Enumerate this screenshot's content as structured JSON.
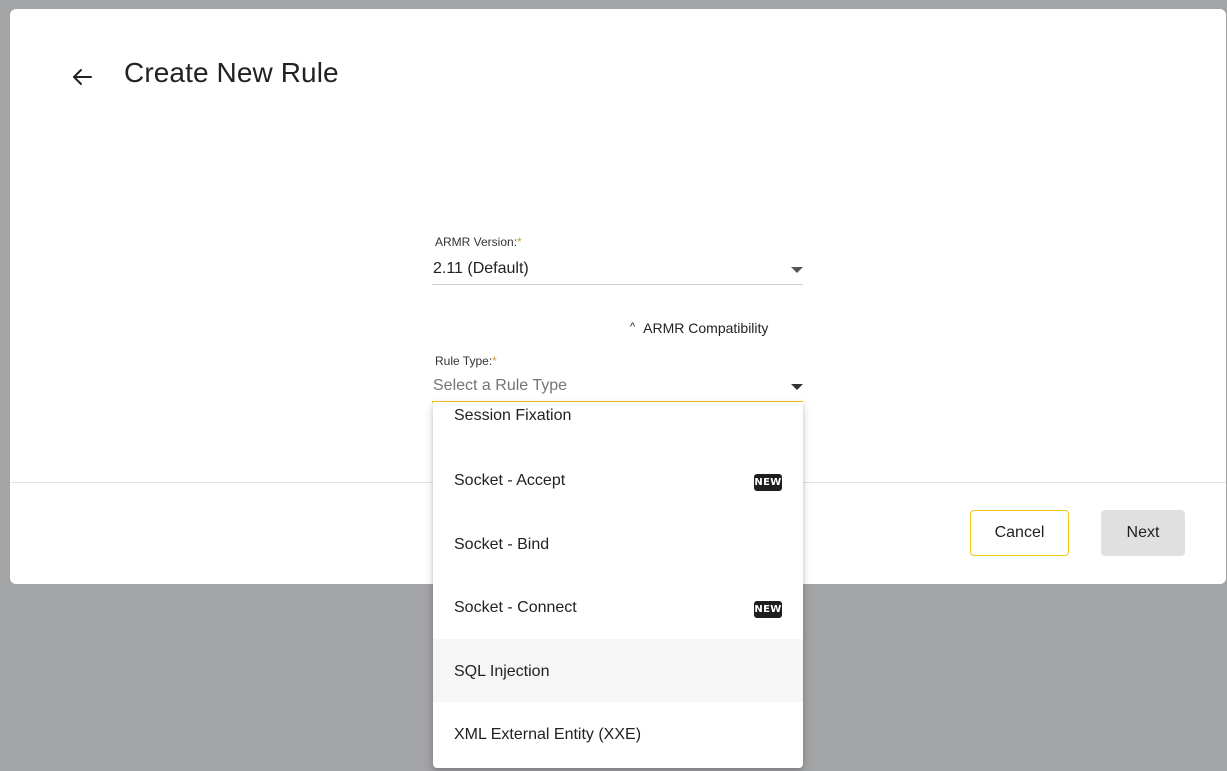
{
  "header": {
    "title": "Create New Rule",
    "back_icon": "arrow-left-icon"
  },
  "form": {
    "armr_version": {
      "label": "ARMR Version:",
      "required_mark": "*",
      "value": "2.11 (Default)"
    },
    "compatibility_toggle": {
      "label": "ARMR Compatibility",
      "icon": "chevron-up-icon",
      "glyph": "^"
    },
    "rule_type": {
      "label": "Rule Type:",
      "required_mark": "*",
      "placeholder": "Select a Rule Type"
    }
  },
  "dropdown": {
    "options": [
      {
        "label": "Session Fixation",
        "badge": ""
      },
      {
        "label": "Socket - Accept",
        "badge": "NEW"
      },
      {
        "label": "Socket - Bind",
        "badge": ""
      },
      {
        "label": "Socket - Connect",
        "badge": "NEW"
      },
      {
        "label": "SQL Injection",
        "badge": ""
      },
      {
        "label": "XML External Entity (XXE)",
        "badge": ""
      }
    ]
  },
  "footer": {
    "cancel_label": "Cancel",
    "next_label": "Next"
  },
  "colors": {
    "accent": "#f2c811",
    "overlay": "#a3a4a6",
    "badge_bg": "#1e1e1e"
  }
}
